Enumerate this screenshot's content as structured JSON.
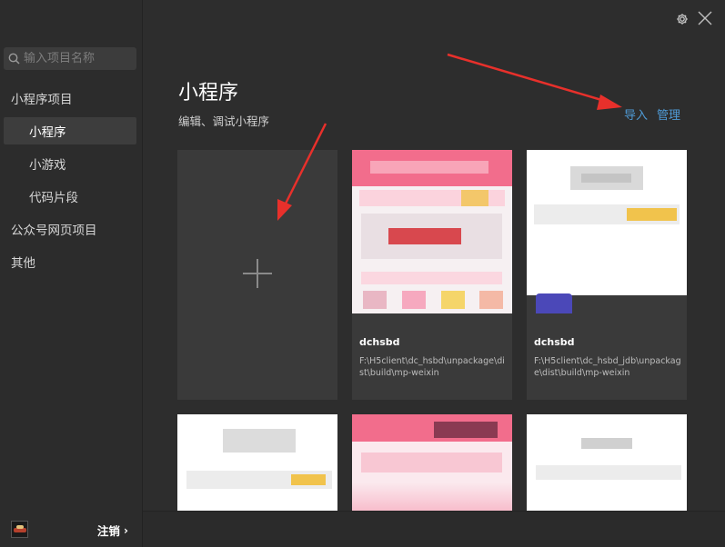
{
  "sidebar": {
    "search_placeholder": "输入项目名称",
    "items": [
      {
        "label": "小程序项目"
      },
      {
        "label": "小程序"
      },
      {
        "label": "小游戏"
      },
      {
        "label": "代码片段"
      },
      {
        "label": "公众号网页项目"
      },
      {
        "label": "其他"
      }
    ],
    "logout_label": "注销",
    "logout_chevron": "›"
  },
  "header": {
    "title": "小程序",
    "subtitle": "编辑、调试小程序",
    "import_label": "导入",
    "manage_label": "管理"
  },
  "icons": {
    "settings": "gear-icon",
    "close": "close-icon",
    "add": "plus-icon",
    "search": "search-icon"
  },
  "projects": [
    {
      "name": "dchsbd",
      "path": "F:\\H5client\\dc_hsbd\\unpackage\\dist\\build\\mp-weixin"
    },
    {
      "name": "dchsbd",
      "path": "F:\\H5client\\dc_hsbd_jdb\\unpackage\\dist\\build\\mp-weixin"
    }
  ],
  "colors": {
    "accent_link": "#4f9bd6",
    "annotation_arrow": "#e8302b",
    "sidebar_bg": "#2c2c2c",
    "main_bg": "#2d2d2d",
    "card_bg": "#3a3a3a"
  }
}
